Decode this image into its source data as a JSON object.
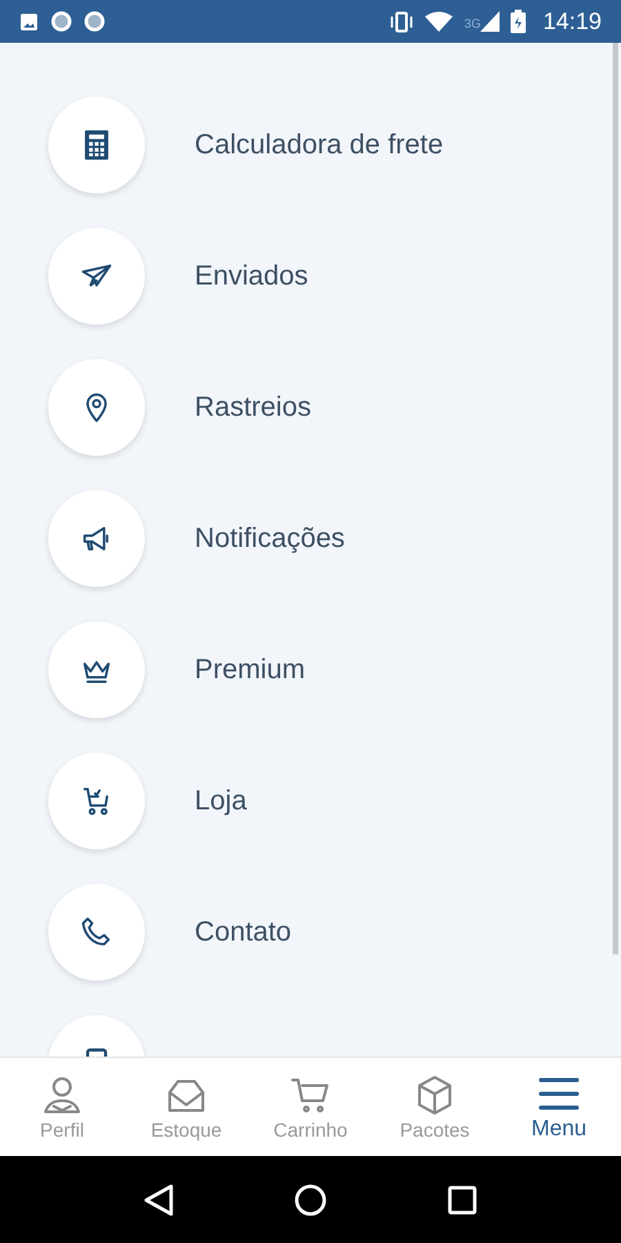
{
  "status_bar": {
    "time": "14:19",
    "network": "3G"
  },
  "menu_items": [
    {
      "label": "Calculadora de frete"
    },
    {
      "label": "Enviados"
    },
    {
      "label": "Rastreios"
    },
    {
      "label": "Notificações"
    },
    {
      "label": "Premium"
    },
    {
      "label": "Loja"
    },
    {
      "label": "Contato"
    }
  ],
  "bottom_nav": [
    {
      "label": "Perfil",
      "selected": false
    },
    {
      "label": "Estoque",
      "selected": false
    },
    {
      "label": "Carrinho",
      "selected": false
    },
    {
      "label": "Pacotes",
      "selected": false
    },
    {
      "label": "Menu",
      "selected": true
    }
  ]
}
